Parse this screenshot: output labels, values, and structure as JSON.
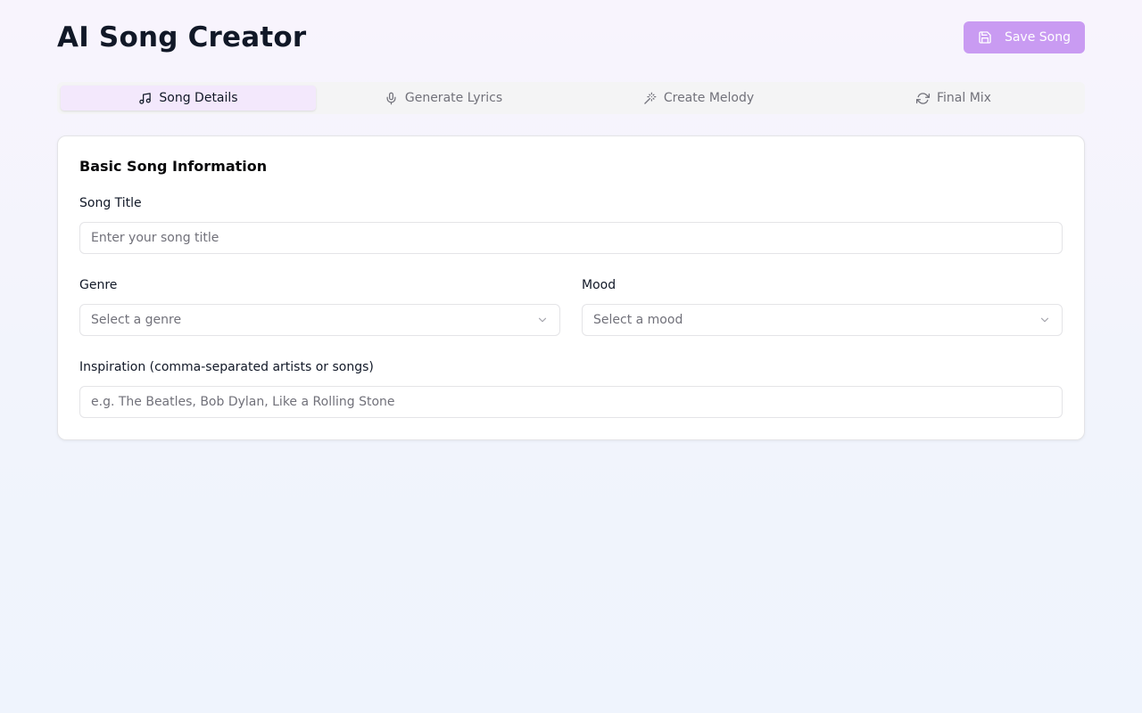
{
  "header": {
    "title": "AI Song Creator",
    "save_label": "Save Song"
  },
  "tabs": [
    {
      "label": "Song Details",
      "icon": "music-icon",
      "active": true
    },
    {
      "label": "Generate Lyrics",
      "icon": "microphone-icon",
      "active": false
    },
    {
      "label": "Create Melody",
      "icon": "magic-wand-icon",
      "active": false
    },
    {
      "label": "Final Mix",
      "icon": "refresh-icon",
      "active": false
    }
  ],
  "card": {
    "title": "Basic Song Information",
    "song_title": {
      "label": "Song Title",
      "placeholder": "Enter your song title",
      "value": ""
    },
    "genre": {
      "label": "Genre",
      "placeholder": "Select a genre"
    },
    "mood": {
      "label": "Mood",
      "placeholder": "Select a mood"
    },
    "inspiration": {
      "label": "Inspiration (comma-separated artists or songs)",
      "placeholder": "e.g. The Beatles, Bob Dylan, Like a Rolling Stone",
      "value": ""
    }
  },
  "colors": {
    "accent": "#c99bf2",
    "active_tab_bg": "#f3e8fc"
  }
}
